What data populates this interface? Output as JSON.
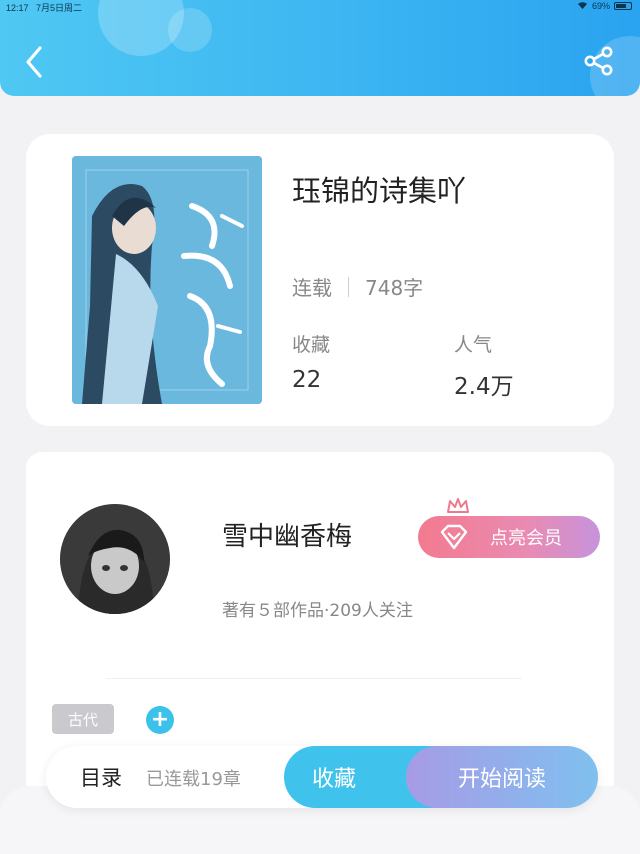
{
  "status_bar": {
    "time": "12:17",
    "date": "7月5日周二",
    "battery": "69%",
    "battery_level": 0.69
  },
  "header": {
    "back_icon": "chevron-left-icon",
    "share_icon": "share-icon",
    "gradient_colors": [
      "#4fc8f3",
      "#2aa3f0"
    ]
  },
  "book": {
    "title": "珏锦的诗集吖",
    "status": "连载",
    "word_count": "748字",
    "favorites_label": "收藏",
    "favorites_value": "22",
    "popularity_label": "人气",
    "popularity_value": "2.4万"
  },
  "author": {
    "name": "雪中幽香梅",
    "meta": "著有５部作品·209人关注",
    "vip_label": "点亮会员",
    "vip_icon": "diamond-icon",
    "crown_icon": "crown-icon"
  },
  "tags": {
    "items": [
      "古代"
    ],
    "add_label": "+"
  },
  "bottom_bar": {
    "toc_label": "目录",
    "toc_count": "已连载19章",
    "collect_label": "收藏",
    "read_label": "开始阅读",
    "accent": "#3fc3ec"
  }
}
